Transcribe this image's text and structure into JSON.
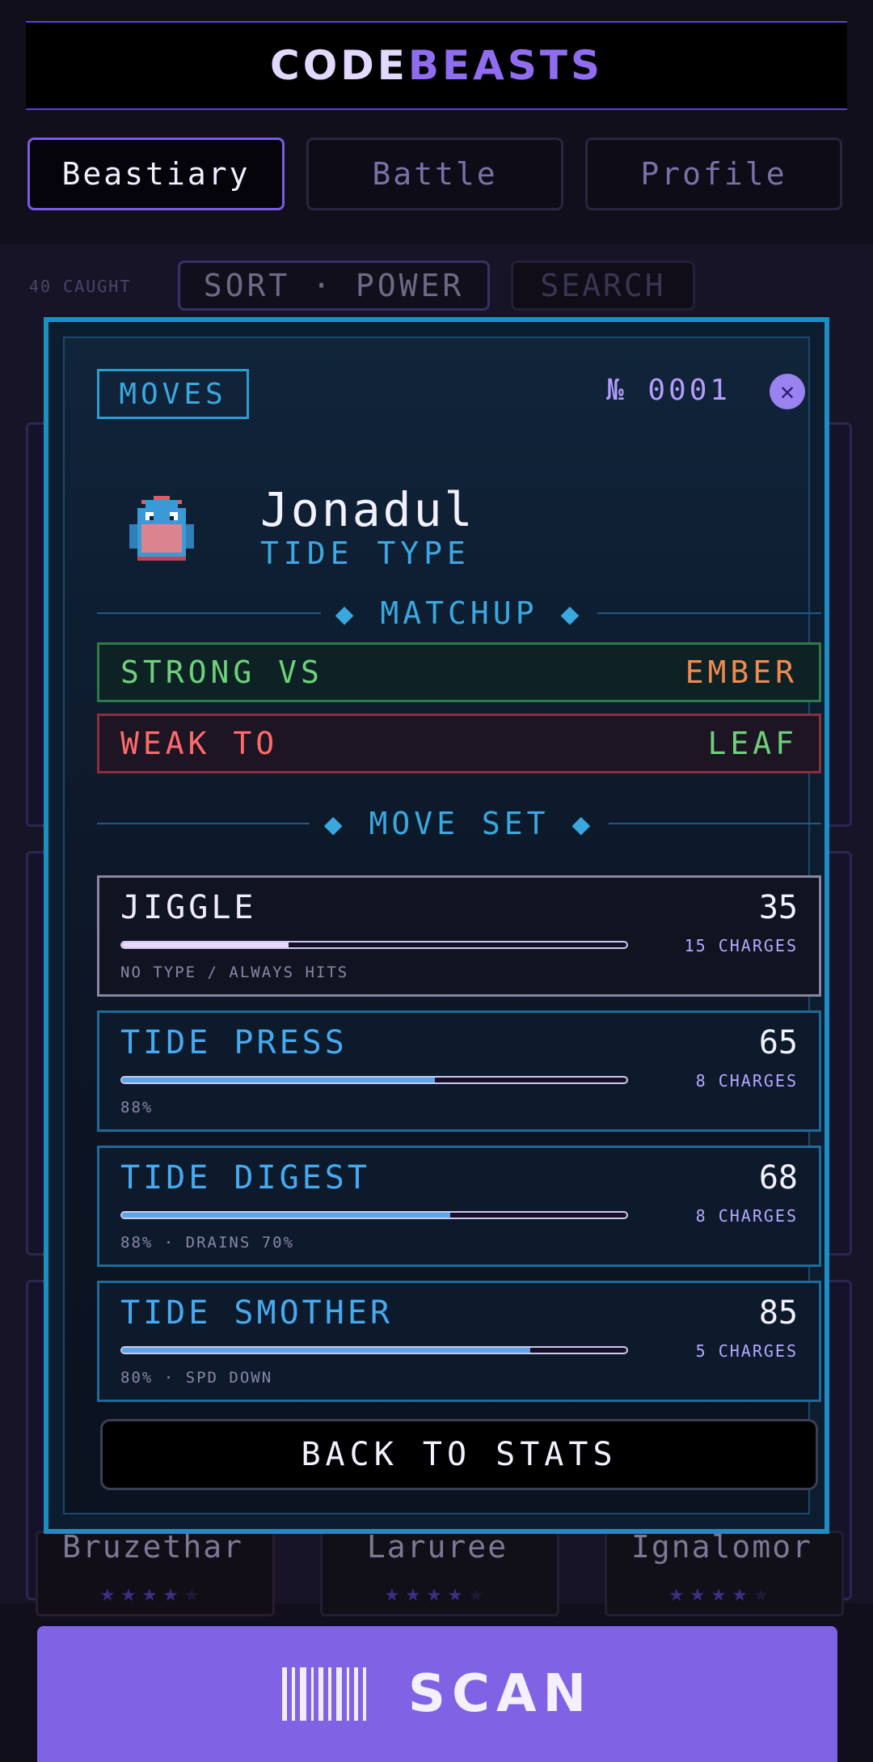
{
  "app": {
    "title_part1": "CODE",
    "title_part2": "BEASTS"
  },
  "tabs": [
    {
      "label": "Beastiary",
      "active": true
    },
    {
      "label": "Battle",
      "active": false
    },
    {
      "label": "Profile",
      "active": false
    }
  ],
  "list": {
    "caught": "40 CAUGHT",
    "sort_label": "SORT · POWER",
    "search_label": "SEARCH",
    "cards": [
      {
        "name": "Bruzethar",
        "stars": 4,
        "max_stars": 5
      },
      {
        "name": "Laruree",
        "stars": 4,
        "max_stars": 5
      },
      {
        "name": "Ignalomor",
        "stars": 4,
        "max_stars": 5
      }
    ]
  },
  "modal": {
    "tag": "MOVES",
    "number": "№ 0001",
    "close_icon": "close-icon",
    "beast": {
      "name": "Jonadul",
      "type": "TIDE TYPE"
    },
    "matchup": {
      "heading": "MATCHUP",
      "strong_label": "STRONG VS",
      "strong_value": "EMBER",
      "weak_label": "WEAK TO",
      "weak_value": "LEAF"
    },
    "moveset_heading": "MOVE SET",
    "moves": [
      {
        "name": "JIGGLE",
        "power": "35",
        "charges": "15 CHARGES",
        "note": "NO TYPE / ALWAYS HITS",
        "bar": 0.33,
        "neutral": true
      },
      {
        "name": "TIDE PRESS",
        "power": "65",
        "charges": "8 CHARGES",
        "note": "88%",
        "bar": 0.62,
        "neutral": false
      },
      {
        "name": "TIDE DIGEST",
        "power": "68",
        "charges": "8 CHARGES",
        "note": "88% · DRAINS 70%",
        "bar": 0.65,
        "neutral": false
      },
      {
        "name": "TIDE SMOTHER",
        "power": "85",
        "charges": "5 CHARGES",
        "note": "80% · SPD DOWN",
        "bar": 0.81,
        "neutral": false
      }
    ],
    "back_button": "BACK TO STATS"
  },
  "scan": {
    "label": "SCAN",
    "icon": "barcode-icon"
  },
  "colors": {
    "accent": "#8062e4",
    "tide": "#3aa8df",
    "strong": "#6ed17a",
    "weak": "#ff6b6b",
    "ember": "#f08a4e"
  }
}
